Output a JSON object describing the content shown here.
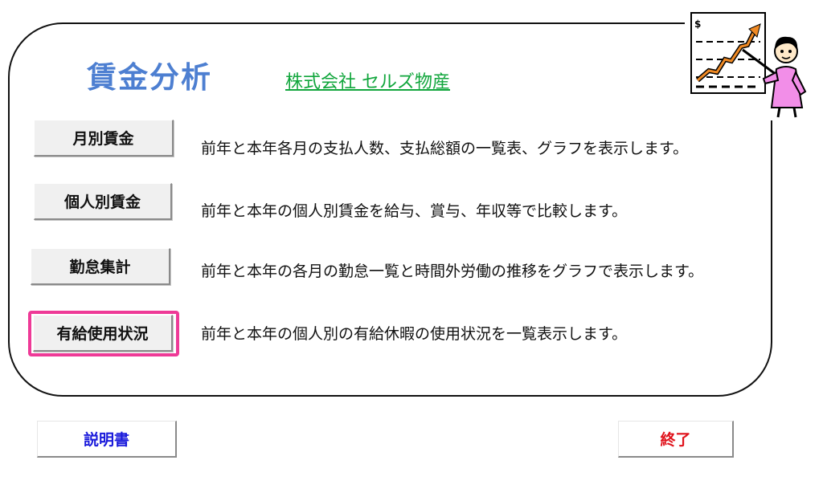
{
  "header": {
    "title": "賃金分析",
    "company": "株式会社 セルズ物産"
  },
  "menu": [
    {
      "label": "月別賃金",
      "description": "前年と本年各月の支払人数、支払総額の一覧表、グラフを表示します。"
    },
    {
      "label": "個人別賃金",
      "description": "前年と本年の個人別賃金を給与、賞与、年収等で比較します。"
    },
    {
      "label": "勤怠集計",
      "description": "前年と本年の各月の勤怠一覧と時間外労働の推移をグラフで表示します。"
    },
    {
      "label": "有給使用状況",
      "description": "前年と本年の個人別の有給休暇の使用状況を一覧表示します。"
    }
  ],
  "footer": {
    "manual_label": "説明書",
    "exit_label": "終了"
  },
  "colors": {
    "title": "#4d7fd1",
    "company_link": "#11a63c",
    "highlight": "#ee3a97",
    "manual_text": "#1a1adb",
    "exit_text": "#e0121b"
  },
  "icons": {
    "mascot": "presenter-chart-icon"
  }
}
